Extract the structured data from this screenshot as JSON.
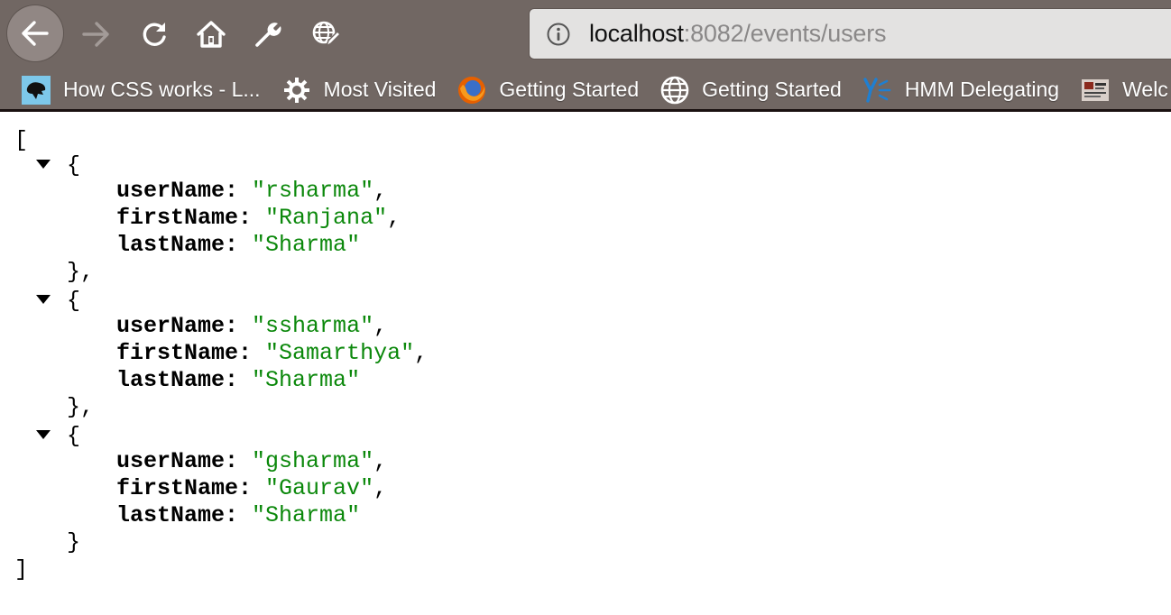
{
  "browser": {
    "nav": {
      "back": "back-arrow",
      "forward": "forward-arrow",
      "reload": "reload",
      "home": "home",
      "tools": "wrench",
      "extension": "globe-pencil"
    },
    "url": {
      "host": "localhost",
      "rest": ":8082/events/users"
    },
    "bookmarks": [
      {
        "label": "How CSS works - L...",
        "icon": "css-site-icon"
      },
      {
        "label": "Most Visited",
        "icon": "gear-icon"
      },
      {
        "label": "Getting Started",
        "icon": "firefox-icon"
      },
      {
        "label": "Getting Started",
        "icon": "globe-icon"
      },
      {
        "label": "HMM Delegating",
        "icon": "yammer-icon"
      },
      {
        "label": "Welc",
        "icon": "site-thumbnail-icon"
      }
    ]
  },
  "json_view": {
    "open_bracket": "[",
    "close_bracket": "]",
    "records": [
      {
        "userName": "\"rsharma\"",
        "firstName": "\"Ranjana\"",
        "lastName": "\"Sharma\""
      },
      {
        "userName": "\"ssharma\"",
        "firstName": "\"Samarthya\"",
        "lastName": "\"Sharma\""
      },
      {
        "userName": "\"gsharma\"",
        "firstName": "\"Gaurav\"",
        "lastName": "\"Sharma\""
      }
    ],
    "keys": {
      "userName": "userName:",
      "firstName": "firstName:",
      "lastName": "lastName:"
    },
    "punct": {
      "open_brace": "{",
      "close_brace_comma": "},",
      "close_brace": "}",
      "comma": ","
    }
  }
}
